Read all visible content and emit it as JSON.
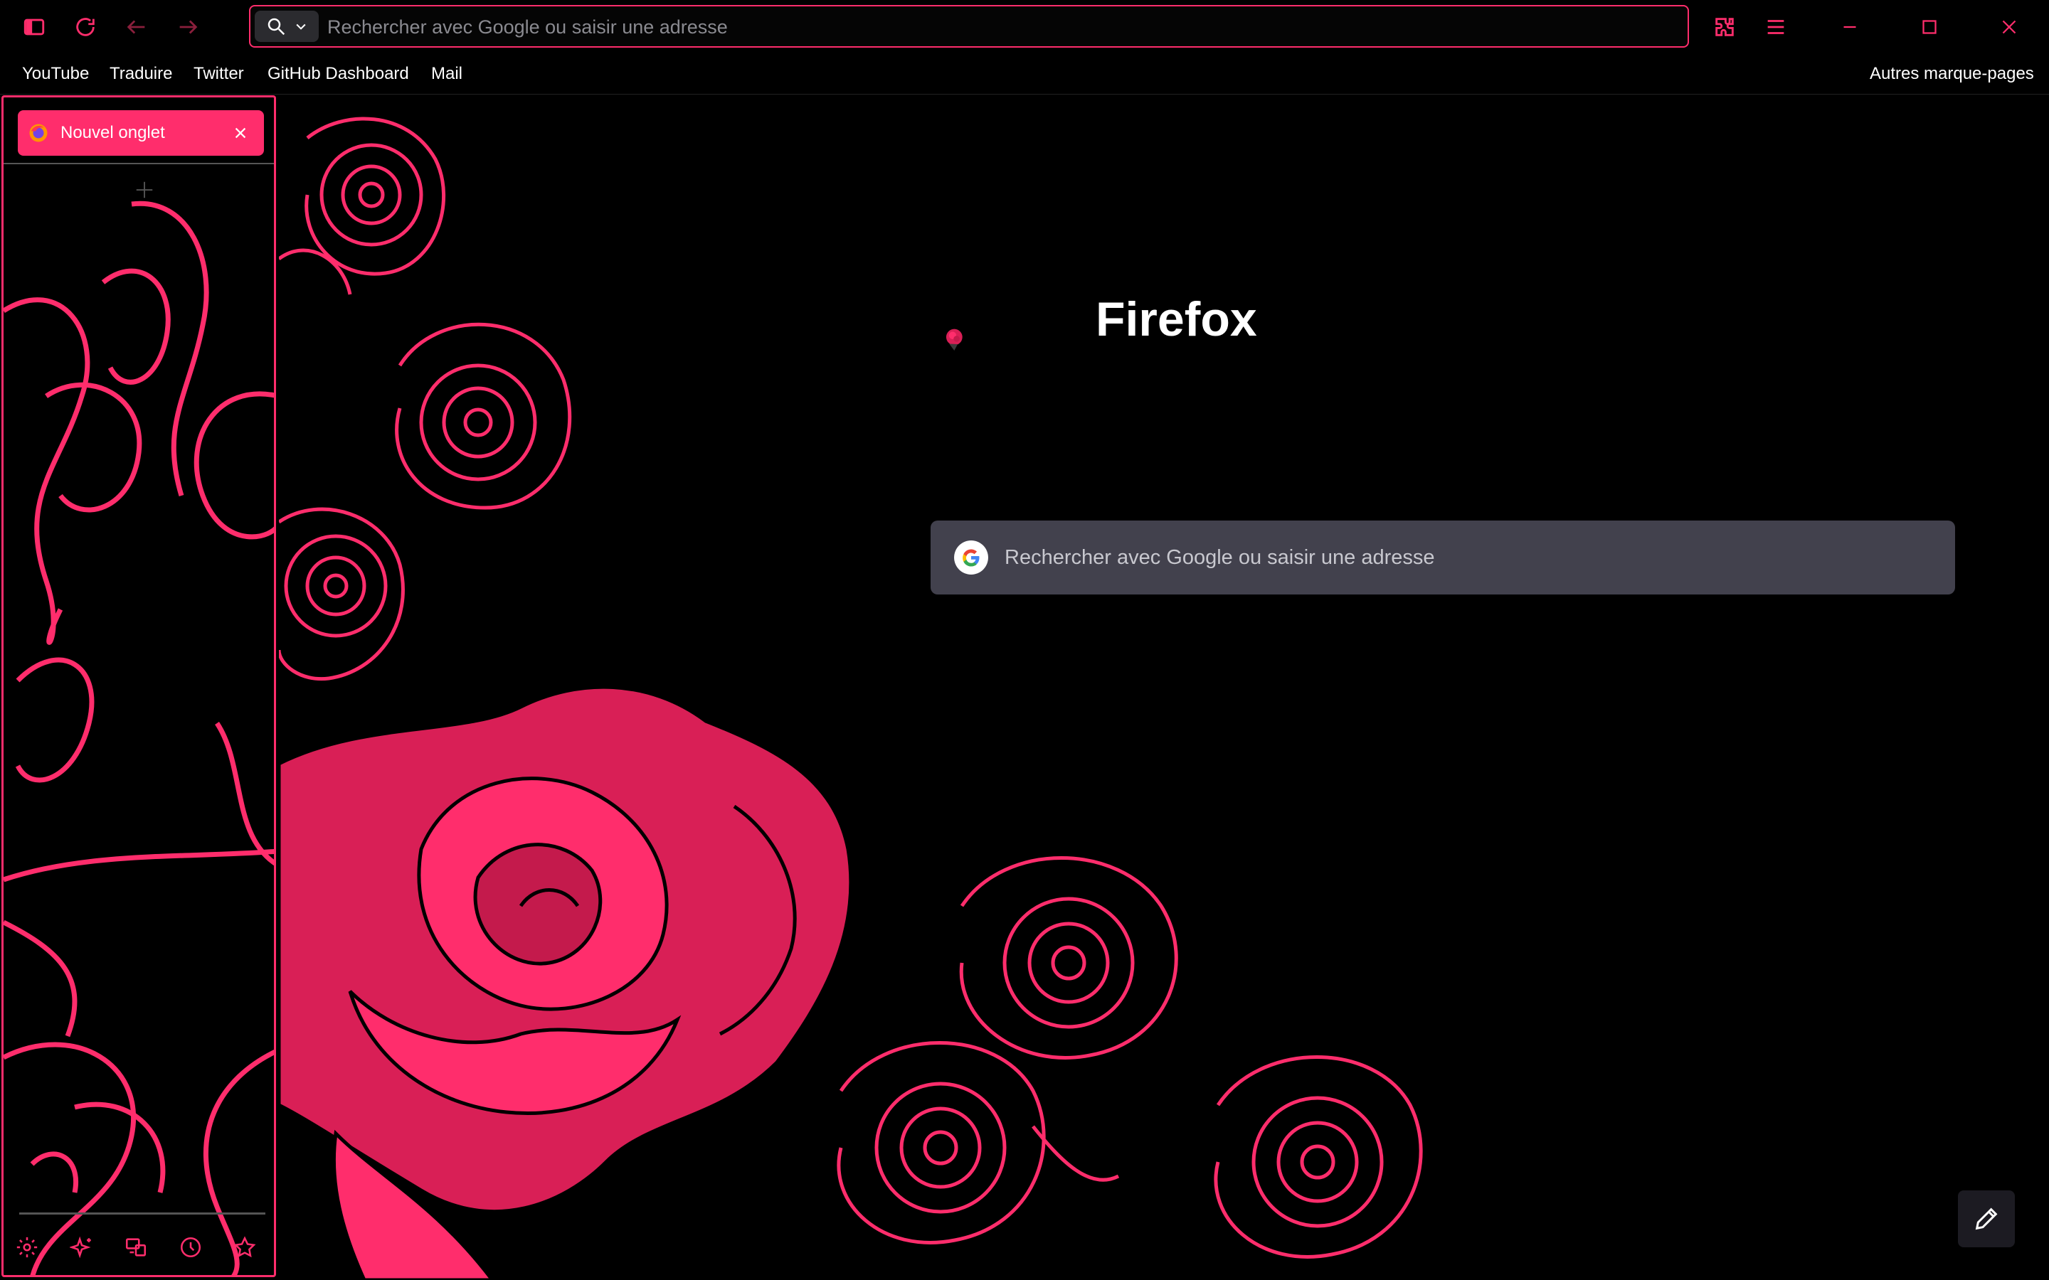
{
  "accent_color": "#ff2d6c",
  "toolbar": {
    "search_placeholder": "Rechercher avec Google ou saisir une adresse",
    "icons": [
      "sidebar-icon",
      "reload-icon",
      "back-icon",
      "forward-icon",
      "search-icon",
      "chevron-down-icon",
      "extensions-icon",
      "menu-icon",
      "minimize-icon",
      "maximize-icon",
      "close-icon"
    ]
  },
  "bookmarks": {
    "items": [
      {
        "label": "YouTube"
      },
      {
        "label": "Traduire"
      },
      {
        "label": "Twitter"
      },
      {
        "label": "GitHub Dashboard"
      },
      {
        "label": "Mail"
      }
    ],
    "other": "Autres marque-pages"
  },
  "sidebar": {
    "tab": {
      "label": "Nouvel onglet",
      "icon": "firefox-icon"
    },
    "new_tab_icon": "plus-icon",
    "bottom_icons": [
      "settings-icon",
      "sparkle-icon",
      "sync-icon",
      "history-icon",
      "bookmarks-star-icon"
    ]
  },
  "newtab": {
    "brand": "Firefox",
    "search_placeholder": "Rechercher avec Google ou saisir une adresse",
    "search_engine_icon": "google-icon",
    "edit_icon": "pencil-icon"
  }
}
